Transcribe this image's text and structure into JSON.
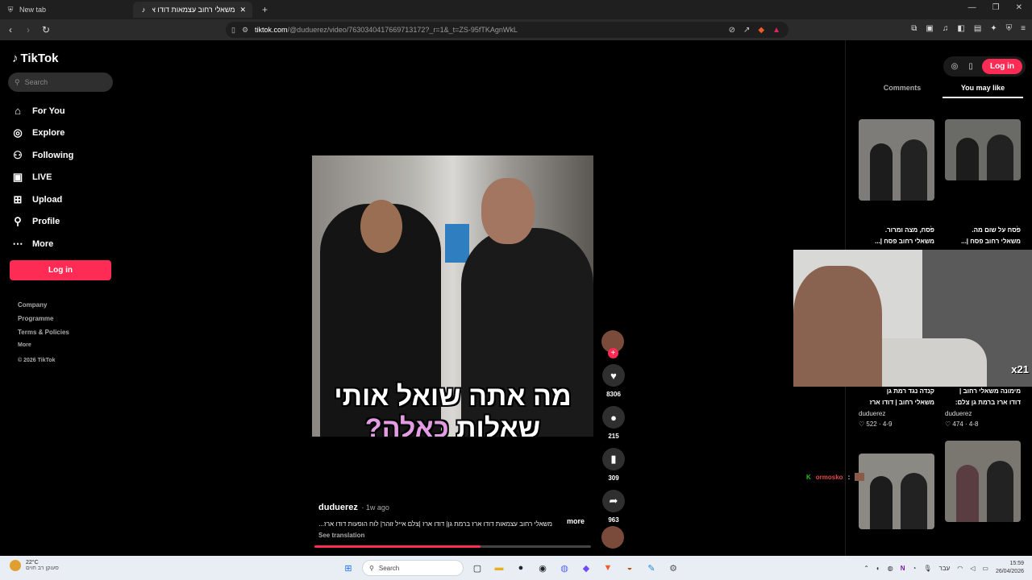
{
  "browser": {
    "tabs": [
      {
        "label": "New tab"
      },
      {
        "label": "משאלי רחוב עצמאות דודו ארז ב"
      }
    ],
    "url_host": "tiktok.com",
    "url_path": "/@duduerez/video/7630340417669713172?_r=1&_t=ZS-95fTKAgnWkL"
  },
  "sidebar": {
    "brand": "TikTok",
    "search_placeholder": "Search",
    "nav": [
      {
        "label": "For You",
        "icon": "home-icon"
      },
      {
        "label": "Explore",
        "icon": "compass-icon"
      },
      {
        "label": "Following",
        "icon": "following-icon"
      },
      {
        "label": "LIVE",
        "icon": "live-icon"
      },
      {
        "label": "Upload",
        "icon": "upload-icon"
      },
      {
        "label": "Profile",
        "icon": "profile-icon"
      },
      {
        "label": "More",
        "icon": "more-icon"
      }
    ],
    "login_label": "Log in",
    "footer": {
      "company": "Company",
      "programme": "Programme",
      "terms": "Terms & Policies",
      "more": "More",
      "copyright": "© 2026 TikTok"
    }
  },
  "video": {
    "caption_line1": "מה אתה שואל אותי",
    "caption_line2_white": "שאלות",
    "caption_line2_pink": "כאלה",
    "caption_line2_q": "?",
    "username": "duduerez",
    "time_ago": "· 1w ago",
    "description": "משאלי רחוב עצמאות דודו ארז ברמת גן| דודו ארז |צלם אייל זוהר| לוח הופעות דודו ארז...",
    "more_label": "more",
    "translation_label": "See translation",
    "progress": 0.6,
    "likes": "8306",
    "comments": "215",
    "saves": "309",
    "shares": "963"
  },
  "right_panel": {
    "login_label": "Log in",
    "tabs": [
      "Comments",
      "You may like"
    ],
    "active_tab": "You may like",
    "items": [
      {
        "title_line1": "פסח, מצה ומרור.",
        "title_line2": "משאלי רחוב פסח |...",
        "author": "",
        "likes": "",
        "date": ""
      },
      {
        "title_line1": "פסח על שום מה.",
        "title_line2": "משאלי רחוב פסח |...",
        "author": "",
        "likes": "",
        "date": ""
      },
      {
        "title_line1": "קנדה נגד רמת גן",
        "title_line2": "משאלי רחוב | דודו ארז",
        "author": "duduerez",
        "likes": "522",
        "date": "4-9"
      },
      {
        "title_line1": "מימונה משאלי רחוב |",
        "title_line2": "דודו ארז ברמת גן צלם:",
        "author": "duduerez",
        "likes": "474",
        "date": "4-8"
      }
    ]
  },
  "overlay": {
    "badge": "x21",
    "chat_name": "ormosko",
    "chat_sep": ":"
  },
  "taskbar": {
    "temp": "22°C",
    "weather_desc": "סעוקן רב חוים",
    "search_label": "Search",
    "lang": "עבר",
    "time": "15:59",
    "date": "26/04/2026"
  }
}
